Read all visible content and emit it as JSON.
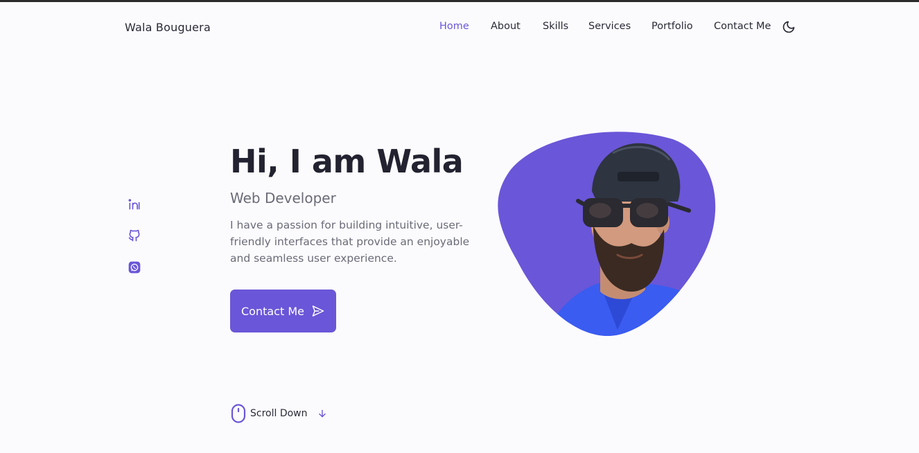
{
  "brand": {
    "name": "Wala Bouguera"
  },
  "nav": {
    "items": [
      {
        "label": "Home",
        "active": true
      },
      {
        "label": "About",
        "active": false
      },
      {
        "label": "Skills",
        "active": false
      },
      {
        "label": "Services",
        "active": false
      },
      {
        "label": "Portfolio",
        "active": false
      },
      {
        "label": "Contact Me",
        "active": false
      }
    ],
    "theme_toggle_icon": "moon-icon"
  },
  "social": [
    {
      "icon": "linkedin-icon"
    },
    {
      "icon": "github-icon"
    },
    {
      "icon": "whatsapp-icon"
    }
  ],
  "hero": {
    "title": "Hi, I am Wala",
    "subtitle": "Web Developer",
    "description": "I have a passion for building intuitive, user-friendly interfaces that provide an enjoyable and seamless user experience.",
    "cta_label": "Contact Me",
    "cta_icon": "send-icon",
    "profile_image_icon": "profile-photo"
  },
  "scroll": {
    "label": "Scroll Down",
    "mouse_icon": "mouse-icon",
    "arrow_icon": "arrow-down-icon"
  },
  "colors": {
    "accent": "#6a56d8",
    "background": "#fbfbfe",
    "title": "#222230",
    "text": "#6b6b78",
    "topbar": "#2b2b2b"
  }
}
